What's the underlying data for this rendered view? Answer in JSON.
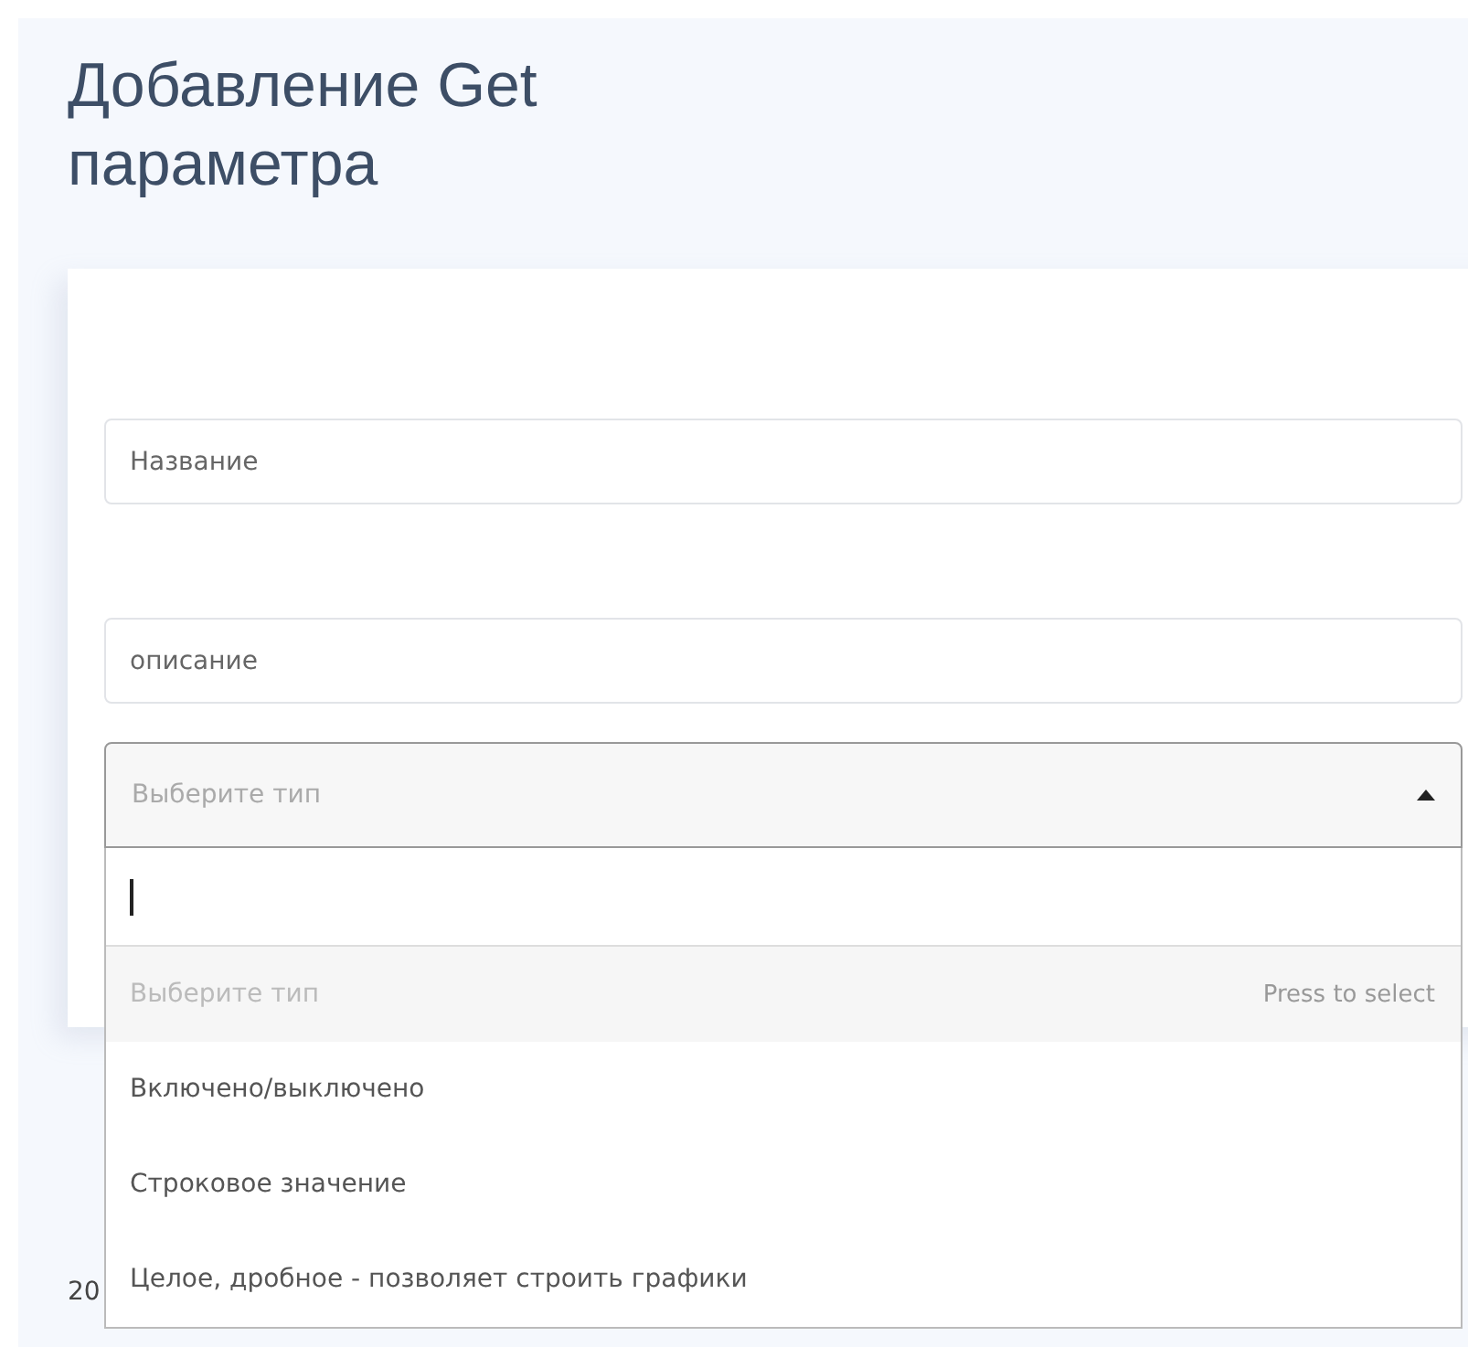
{
  "title": "Добавление Get параметра",
  "fields": [
    {
      "placeholder": "Название"
    },
    {
      "placeholder": "описание"
    }
  ],
  "select": {
    "placeholder": "Выберите тип",
    "expanded": true,
    "options": [
      {
        "label": "Выберите тип",
        "selected": true,
        "hint": "Press to select",
        "disabled": true
      },
      {
        "label": "Включено/выключено",
        "selected": false,
        "disabled": false
      },
      {
        "label": "Строковое значение",
        "selected": false,
        "disabled": false
      },
      {
        "label": "Целое, дробное - позволяет строить графики",
        "selected": false,
        "disabled": false
      }
    ]
  },
  "footer": "20"
}
